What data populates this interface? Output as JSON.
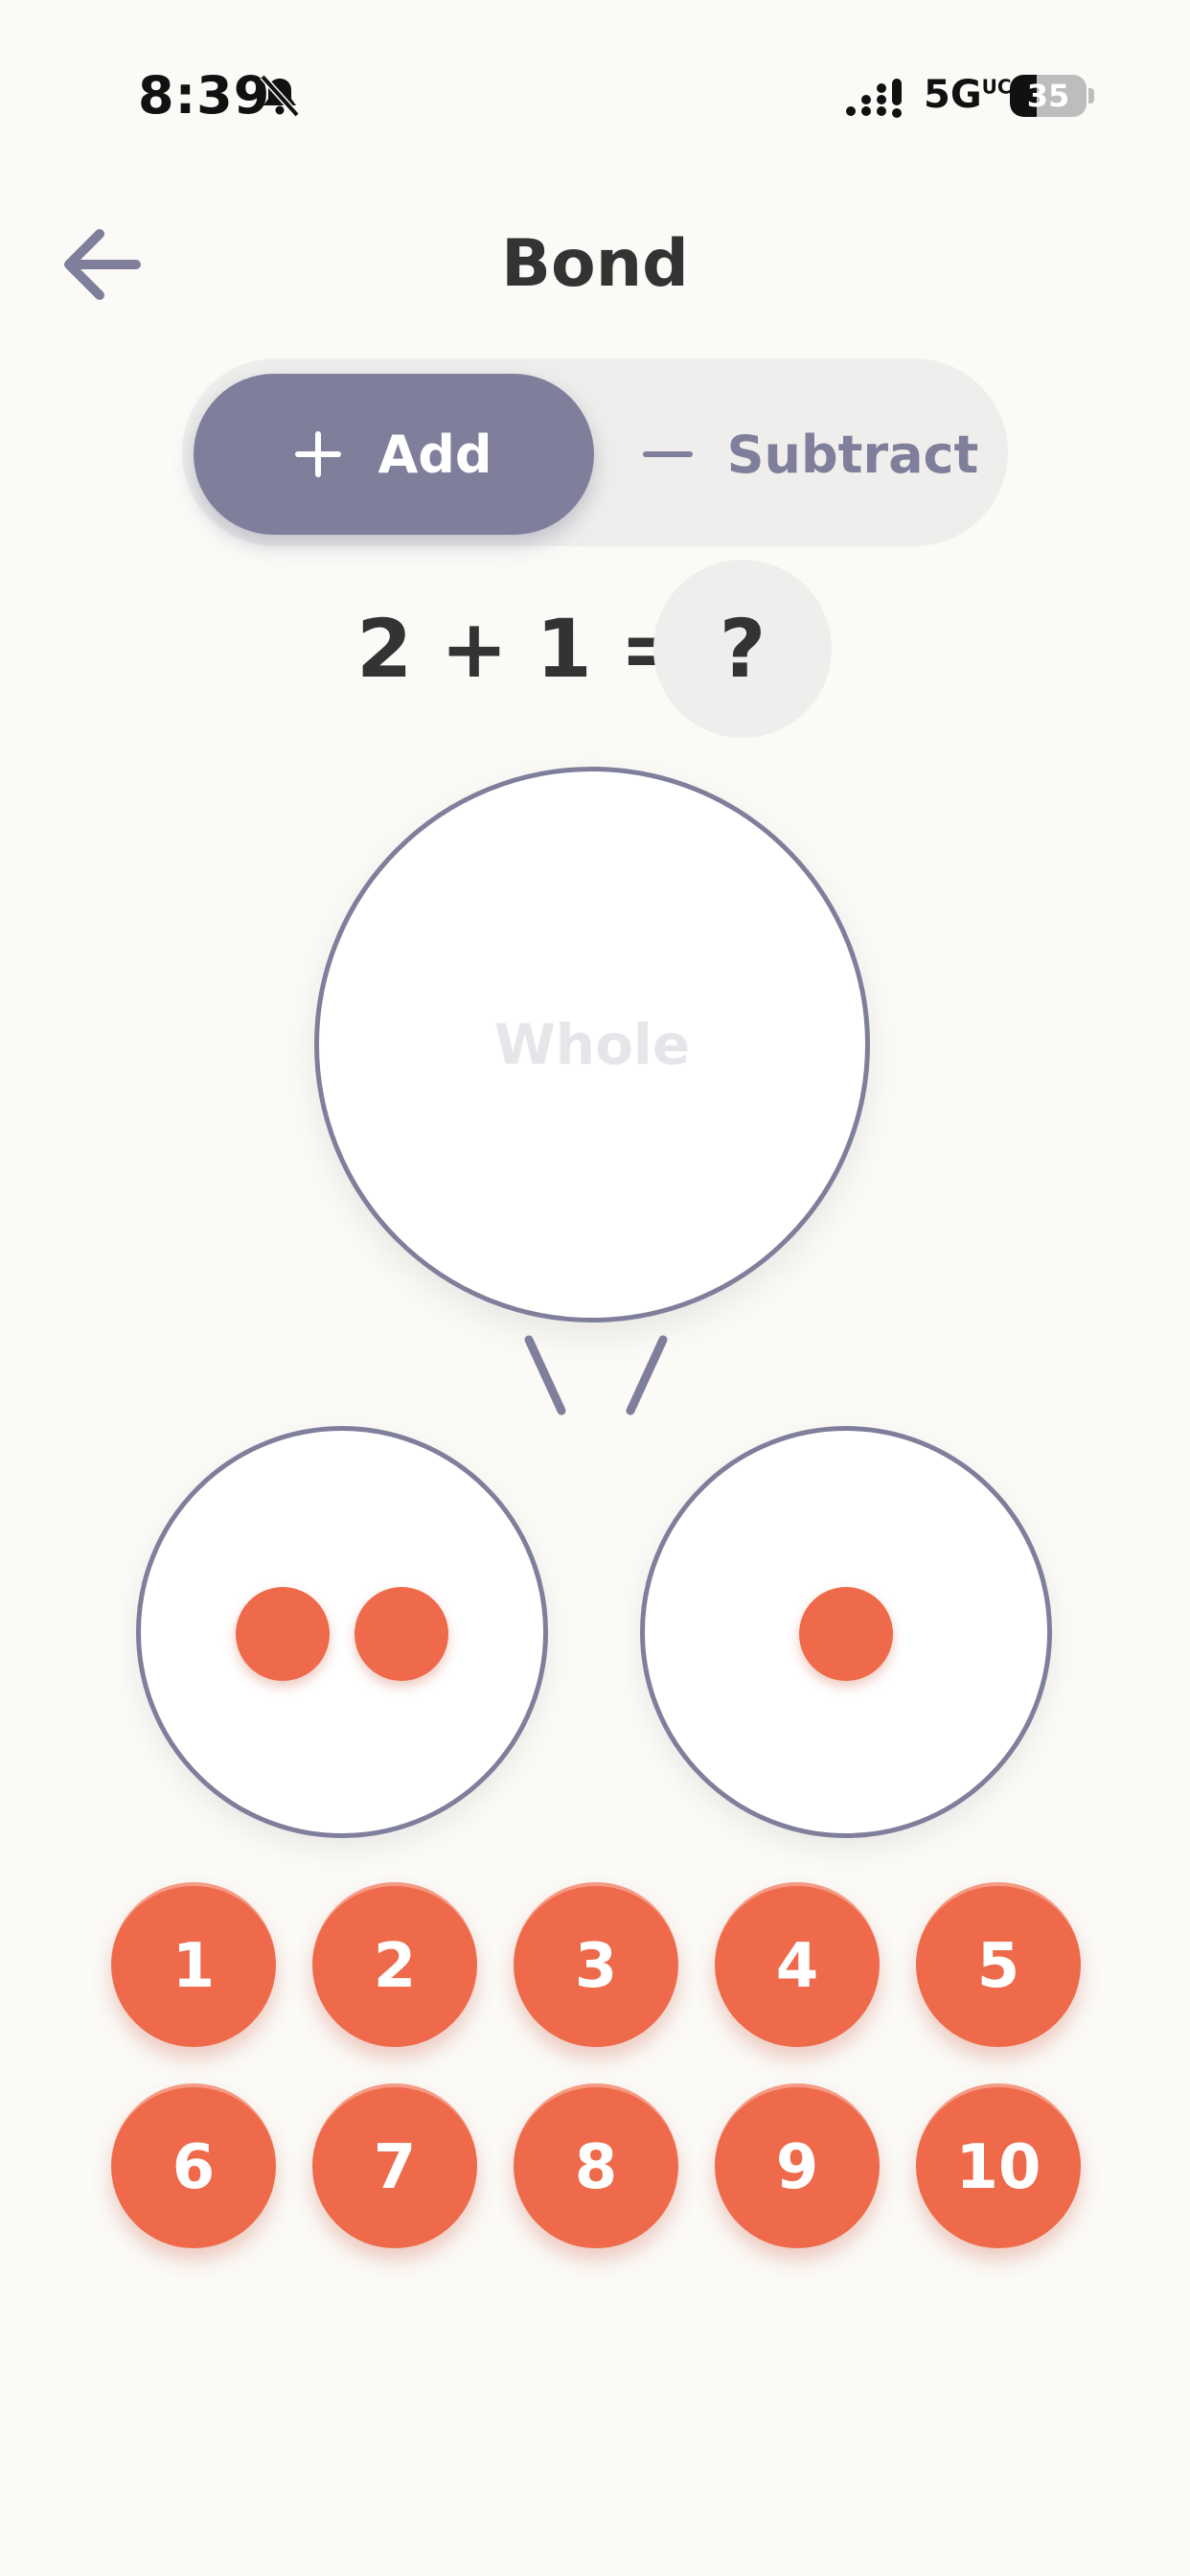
{
  "status_bar": {
    "time": "8:39",
    "network": "5G",
    "network_superscript": "UC",
    "battery": "35",
    "battery_level": 0.35
  },
  "header": {
    "title": "Bond"
  },
  "mode_toggle": {
    "add_label": "Add",
    "subtract_label": "Subtract",
    "selected": "Add"
  },
  "problem": {
    "equation": "2 + 1 =",
    "answer_placeholder": "?"
  },
  "bond": {
    "whole_label": "Whole",
    "left_part_count": 2,
    "right_part_count": 1
  },
  "number_pad": [
    "1",
    "2",
    "3",
    "4",
    "5",
    "6",
    "7",
    "8",
    "9",
    "10"
  ],
  "colors": {
    "accent": "#7f7f9c",
    "dot": "#ee6a4b",
    "background": "#fbfaf7"
  }
}
